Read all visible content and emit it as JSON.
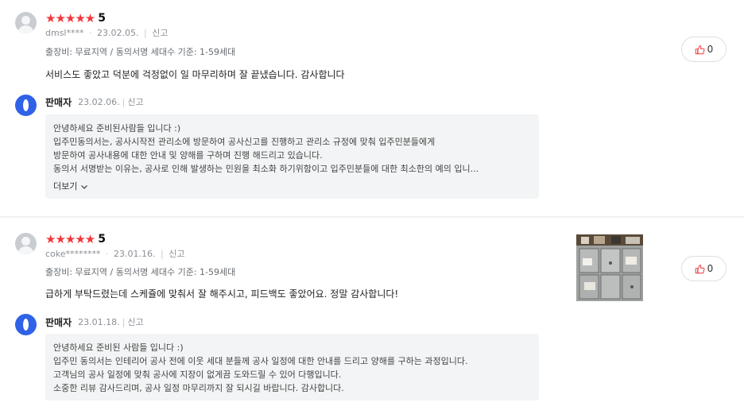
{
  "reviews": [
    {
      "rating_stars": "★★★★★",
      "score": "5",
      "user": "dmsl****",
      "date": "23.02.05.",
      "report_label": "신고",
      "info": "출장비: 무료지역 / 동의서명 세대수 기준: 1-59세대",
      "text": "서비스도 좋았고 덕분에 걱정없이 일 마무리하며 잘 끝냈습니다. 감사합니다",
      "likes": "0",
      "seller": {
        "name": "판매자",
        "date": "23.02.06.",
        "report_label": "신고",
        "lines": [
          "안녕하세요 준비된사람들 입니다 :)",
          "입주민동의서는, 공사시작전 관리소에 방문하여 공사신고를 진행하고 관리소 규정에 맞춰 입주민분들에게",
          "방문하여 공사내용에 대한 안내 및 양해를 구하며 진행 해드리고 있습니다.",
          "동의서 서명받는 이유는, 공사로 인해 발생하는 민원을 최소화 하기위함이고 입주민분들에 대한 최소한의 예의 입니..."
        ],
        "more_label": "더보기"
      }
    },
    {
      "rating_stars": "★★★★★",
      "score": "5",
      "user": "coke********",
      "date": "23.01.16.",
      "report_label": "신고",
      "info": "출장비: 무료지역 / 동의서명 세대수 기준: 1-59세대",
      "text": "급하게 부탁드렸는데 스케쥴에 맞춰서 잘 해주시고, 피드백도 좋았어요. 정말 감사합니다!",
      "likes": "0",
      "photo_icon": "review-photo",
      "seller": {
        "name": "판매자",
        "date": "23.01.18.",
        "report_label": "신고",
        "lines": [
          "안녕하세요 준비된 사람들 입니다 :)",
          "입주민 동의서는 인테리어 공사 전에 이웃 세대 분들께 공사 일정에 대한 안내를 드리고 양해를 구하는 과정입니다.",
          "고객님의 공사 일정에 맞춰 공사에 지장이 없게끔 도와드릴 수 있어 다행입니다.",
          "소중한 리뷰 감사드리며, 공사 일정 마무리까지 잘 되시길 바랍니다. 감사합니다."
        ]
      }
    }
  ],
  "colors": {
    "star": "#f0373d",
    "seller_avatar": "#2f62e6",
    "reply_bg": "#f3f4f5",
    "like_icon": "#f0373d"
  }
}
